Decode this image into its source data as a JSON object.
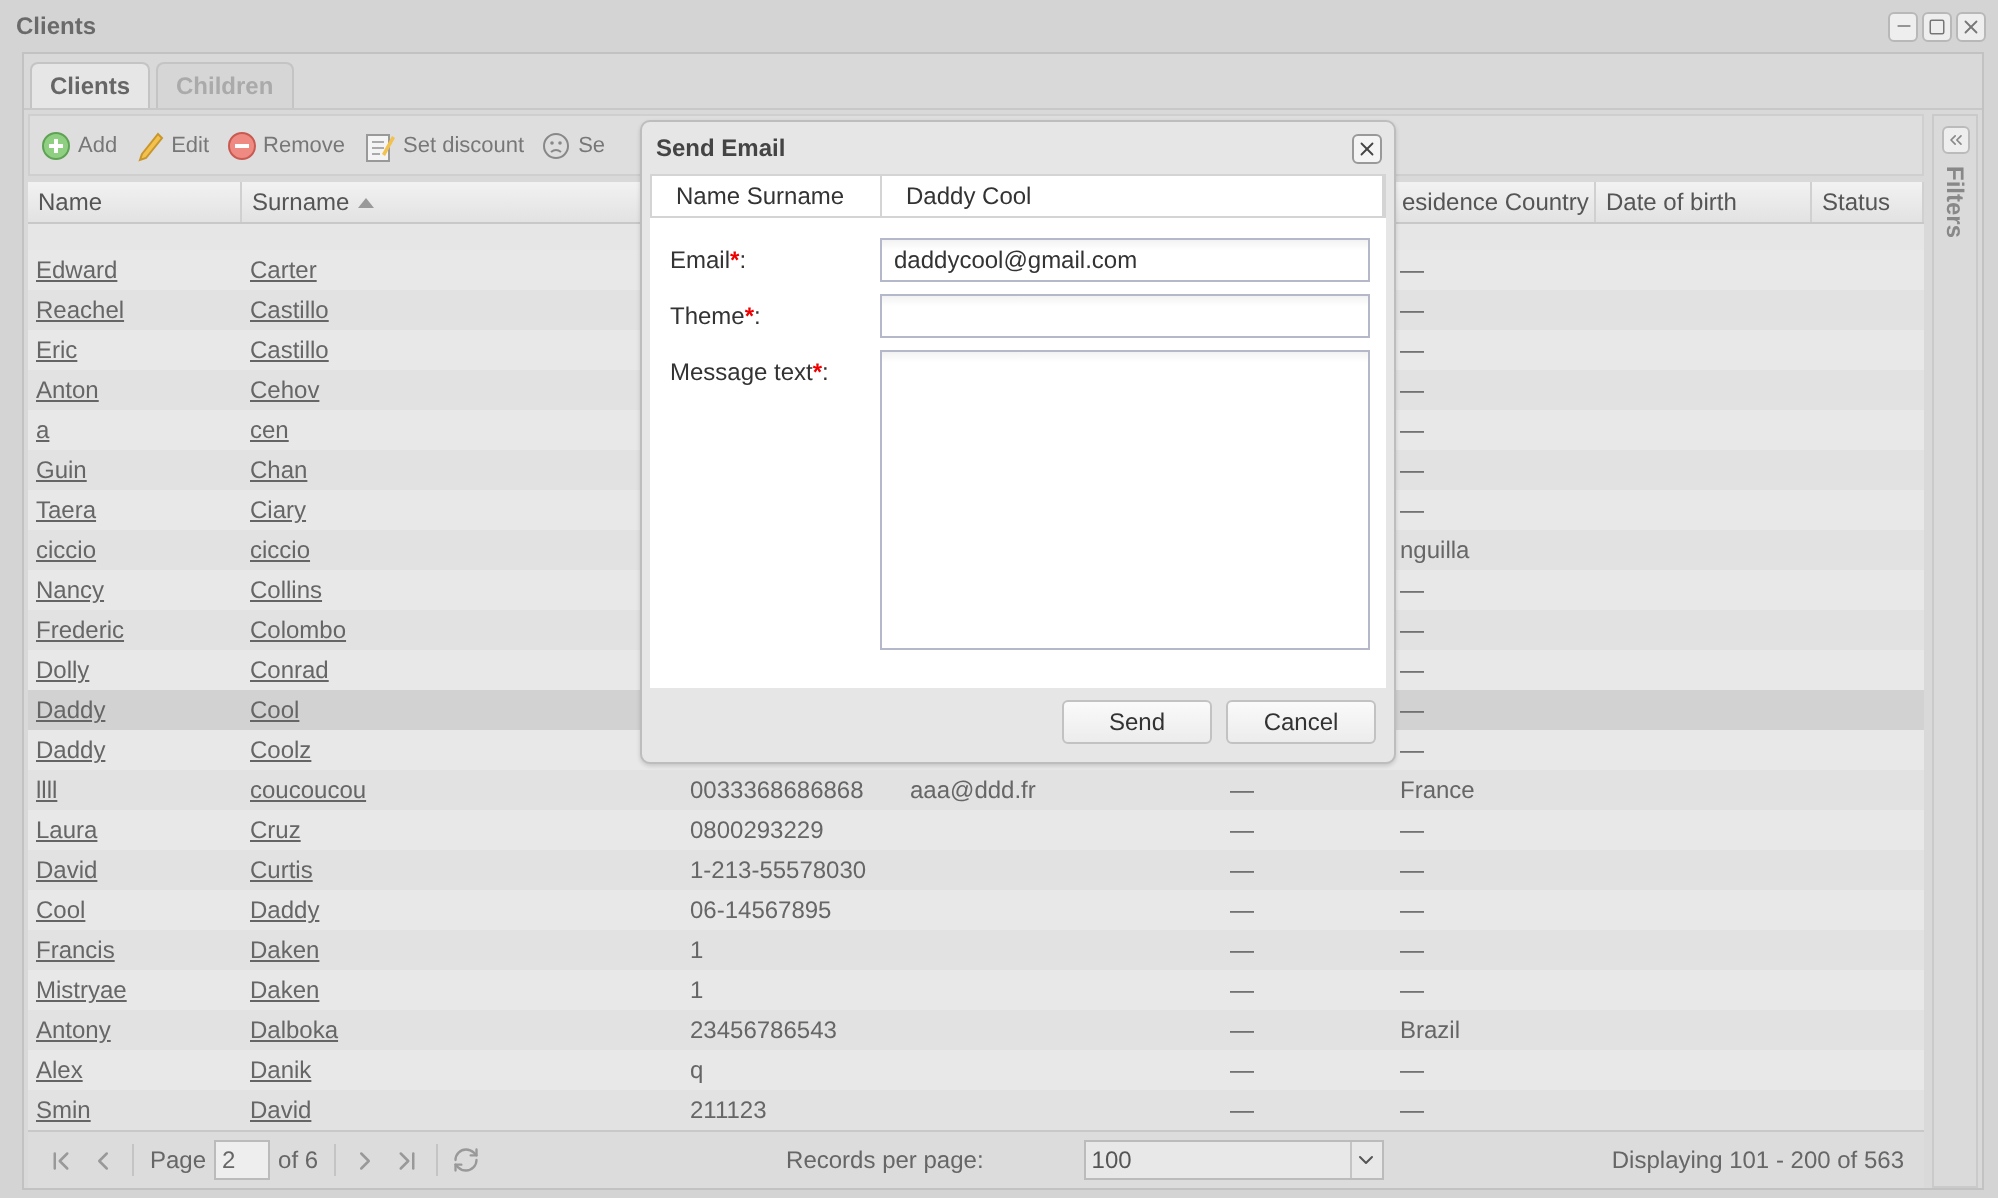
{
  "window": {
    "title": "Clients"
  },
  "tabs": [
    {
      "label": "Clients",
      "selected": true
    },
    {
      "label": "Children",
      "selected": false
    }
  ],
  "toolbar": [
    {
      "kind": "add",
      "label": "Add"
    },
    {
      "kind": "edit",
      "label": "Edit"
    },
    {
      "kind": "remove",
      "label": "Remove"
    },
    {
      "kind": "discount",
      "label": "Set discount"
    },
    {
      "kind": "face",
      "label": "Se"
    }
  ],
  "table": {
    "columns": [
      {
        "label": "Name",
        "sorted": false
      },
      {
        "label": "Surname",
        "sorted": true
      },
      null,
      null,
      null,
      {
        "label": "esidence Country",
        "sorted": false
      },
      {
        "label": "Date of birth",
        "sorted": false
      },
      {
        "label": "Status",
        "sorted": false
      }
    ],
    "rows": [
      {
        "cells": [
          "Edward",
          "Carter",
          null,
          null,
          null,
          "—"
        ],
        "selected": false
      },
      {
        "cells": [
          "Reachel",
          "Castillo",
          null,
          null,
          null,
          "—"
        ],
        "selected": false
      },
      {
        "cells": [
          "Eric",
          "Castillo",
          null,
          null,
          null,
          "—"
        ],
        "selected": false
      },
      {
        "cells": [
          "Anton",
          "Cehov",
          null,
          null,
          null,
          "—"
        ],
        "selected": false
      },
      {
        "cells": [
          "a",
          "cen",
          null,
          null,
          null,
          "—"
        ],
        "selected": false
      },
      {
        "cells": [
          "Guin",
          "Chan",
          null,
          null,
          null,
          "—"
        ],
        "selected": false
      },
      {
        "cells": [
          "Taera",
          "Ciary",
          null,
          null,
          null,
          "—"
        ],
        "selected": false
      },
      {
        "cells": [
          "ciccio",
          "ciccio",
          null,
          null,
          null,
          "nguilla"
        ],
        "selected": false
      },
      {
        "cells": [
          "Nancy",
          "Collins",
          null,
          null,
          null,
          "—"
        ],
        "selected": false
      },
      {
        "cells": [
          "Frederic",
          "Colombo",
          null,
          null,
          null,
          "—"
        ],
        "selected": false
      },
      {
        "cells": [
          "Dolly",
          "Conrad",
          null,
          null,
          null,
          "—"
        ],
        "selected": false
      },
      {
        "cells": [
          "Daddy",
          "Cool",
          null,
          null,
          null,
          "—"
        ],
        "selected": true
      },
      {
        "cells": [
          "Daddy",
          "Coolz",
          null,
          null,
          null,
          "—"
        ],
        "selected": false
      },
      {
        "cells": [
          "llll",
          "coucoucou",
          "0033368686868",
          "aaa@ddd.fr",
          "—",
          "France"
        ],
        "selected": false
      },
      {
        "cells": [
          "Laura",
          "Cruz",
          "0800293229",
          null,
          "—",
          "—"
        ],
        "selected": false
      },
      {
        "cells": [
          "David",
          "Curtis",
          "1-213-55578030",
          null,
          "—",
          "—"
        ],
        "selected": false
      },
      {
        "cells": [
          "Cool",
          "Daddy",
          "06-14567895",
          null,
          "—",
          "—"
        ],
        "selected": false
      },
      {
        "cells": [
          "Francis",
          "Daken",
          "1",
          null,
          "—",
          "—"
        ],
        "selected": false
      },
      {
        "cells": [
          "Mistryae",
          "Daken",
          "1",
          null,
          "—",
          "—"
        ],
        "selected": false
      },
      {
        "cells": [
          "Antony",
          "Dalboka",
          "23456786543",
          null,
          "—",
          "Brazil"
        ],
        "selected": false
      },
      {
        "cells": [
          "Alex",
          "Danik",
          "q",
          null,
          "—",
          "—"
        ],
        "selected": false
      },
      {
        "cells": [
          "Smin",
          "David",
          "211123",
          null,
          "—",
          "—"
        ],
        "selected": false
      }
    ]
  },
  "pager": {
    "page_label": "Page",
    "page": "2",
    "of": "of 6",
    "records_label": "Records per page:",
    "records_per_page": "100",
    "display": "Displaying 101 - 200 of 563"
  },
  "filters": {
    "label": "Filters"
  },
  "dialog": {
    "title": "Send Email",
    "info": {
      "label": "Name Surname",
      "value": "Daddy Cool"
    },
    "fields": [
      {
        "kind": "input",
        "label": "Email",
        "required_mark": "*",
        "separator": ":",
        "value": "daddycool@gmail.com"
      },
      {
        "kind": "input",
        "label": "Theme",
        "required_mark": "*",
        "separator": ":"
      },
      {
        "kind": "textarea",
        "label": "Message text",
        "required_mark": "*",
        "separator": ":"
      }
    ],
    "buttons": [
      "Send",
      "Cancel"
    ]
  }
}
